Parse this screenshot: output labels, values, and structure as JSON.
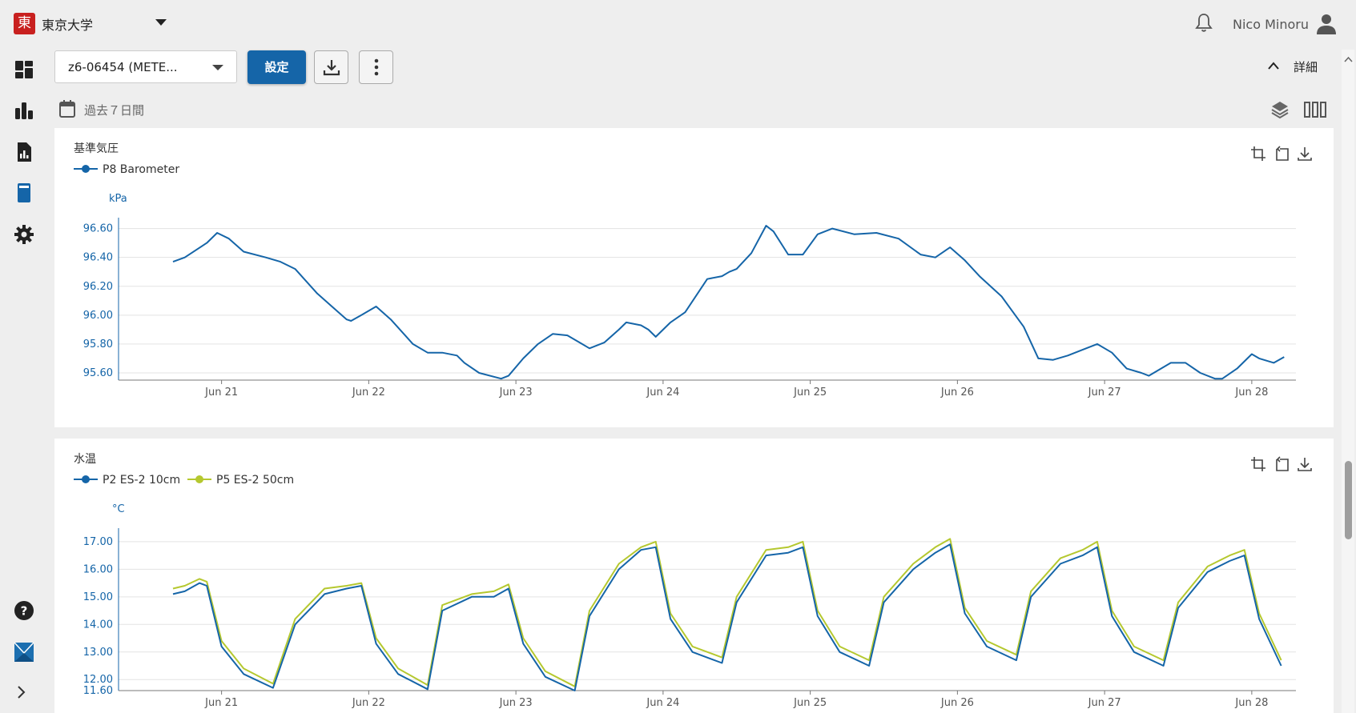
{
  "header": {
    "logo_char": "東",
    "org_name": "東京大学",
    "user_name": "Nico Minoru"
  },
  "toolbar": {
    "device_select_value": "z6-06454 (METE...",
    "settings_label": "設定",
    "details_label": "詳細",
    "period_label": "過去７日間"
  },
  "colors": {
    "accent": "#1565a8",
    "series_blue": "#1565a8",
    "series_green": "#b5c82f",
    "logo_red": "#c8201f"
  },
  "icons": {
    "sidebar": [
      "dashboard-icon",
      "bar-chart-icon",
      "report-icon",
      "notebook-icon",
      "gear-icon",
      "help-icon",
      "app-logo-icon",
      "chevron-right-icon"
    ],
    "toolbar": [
      "download-icon",
      "more-vert-icon",
      "layers-icon",
      "columns-icon",
      "calendar-icon"
    ],
    "chart": [
      "crop-icon",
      "reset-icon",
      "download-icon"
    ]
  },
  "chart_data": [
    {
      "type": "line",
      "title": "基準気圧",
      "ylabel": "kPa",
      "ylim": [
        95.55,
        96.62
      ],
      "yticks": [
        "96.60",
        "96.40",
        "96.20",
        "96.00",
        "95.80",
        "95.60"
      ],
      "xticks": [
        "Jun 21",
        "Jun 22",
        "Jun 23",
        "Jun 24",
        "Jun 25",
        "Jun 26",
        "Jun 27",
        "Jun 28"
      ],
      "xlim": [
        20.3,
        28.3
      ],
      "grid": true,
      "legend": "top-left",
      "series": [
        {
          "name": "P8 Barometer",
          "color": "#1565a8",
          "x": [
            20.67,
            20.75,
            20.9,
            20.97,
            21.05,
            21.15,
            21.3,
            21.4,
            21.5,
            21.65,
            21.75,
            21.85,
            21.88,
            21.95,
            22.05,
            22.15,
            22.3,
            22.4,
            22.5,
            22.6,
            22.65,
            22.75,
            22.9,
            22.95,
            23.05,
            23.15,
            23.25,
            23.35,
            23.45,
            23.5,
            23.6,
            23.7,
            23.75,
            23.85,
            23.9,
            23.95,
            24.05,
            24.15,
            24.3,
            24.4,
            24.45,
            24.5,
            24.6,
            24.7,
            24.75,
            24.85,
            24.95,
            25.05,
            25.15,
            25.3,
            25.45,
            25.6,
            25.75,
            25.85,
            25.95,
            26.05,
            26.15,
            26.3,
            26.45,
            26.55,
            26.65,
            26.75,
            26.85,
            26.95,
            27.05,
            27.15,
            27.25,
            27.3,
            27.45,
            27.55,
            27.65,
            27.75,
            27.8,
            27.9,
            28.0,
            28.05,
            28.15,
            28.22
          ],
          "y": [
            96.37,
            96.4,
            96.5,
            96.57,
            96.53,
            96.44,
            96.4,
            96.37,
            96.32,
            96.15,
            96.06,
            95.97,
            95.96,
            96.0,
            96.06,
            95.97,
            95.8,
            95.74,
            95.74,
            95.72,
            95.67,
            95.6,
            95.56,
            95.58,
            95.7,
            95.8,
            95.87,
            95.86,
            95.8,
            95.77,
            95.81,
            95.9,
            95.95,
            95.93,
            95.9,
            95.85,
            95.95,
            96.02,
            96.25,
            96.27,
            96.3,
            96.32,
            96.43,
            96.62,
            96.58,
            96.42,
            96.42,
            96.56,
            96.6,
            96.56,
            96.57,
            96.53,
            96.42,
            96.4,
            96.47,
            96.38,
            96.27,
            96.13,
            95.92,
            95.7,
            95.69,
            95.72,
            95.76,
            95.8,
            95.74,
            95.63,
            95.6,
            95.58,
            95.67,
            95.67,
            95.6,
            95.56,
            95.56,
            95.63,
            95.73,
            95.7,
            95.67,
            95.71
          ]
        }
      ]
    },
    {
      "type": "line",
      "title": "水温",
      "ylabel": "°C",
      "ylim": [
        11.6,
        17.2
      ],
      "yticks": [
        "17.00",
        "16.00",
        "15.00",
        "14.00",
        "13.00",
        "12.00",
        "11.60"
      ],
      "xticks": [
        "Jun 21",
        "Jun 22",
        "Jun 23",
        "Jun 24",
        "Jun 25",
        "Jun 26",
        "Jun 27",
        "Jun 28"
      ],
      "xlim": [
        20.3,
        28.3
      ],
      "grid": true,
      "legend": "top-left",
      "series": [
        {
          "name": "P2 ES-2 10cm",
          "color": "#1565a8",
          "x": [
            20.67,
            20.75,
            20.85,
            20.9,
            21.0,
            21.15,
            21.35,
            21.5,
            21.7,
            21.85,
            21.95,
            22.05,
            22.2,
            22.4,
            22.5,
            22.7,
            22.85,
            22.95,
            23.05,
            23.2,
            23.4,
            23.5,
            23.7,
            23.85,
            23.95,
            24.05,
            24.2,
            24.4,
            24.5,
            24.7,
            24.85,
            24.95,
            25.05,
            25.2,
            25.4,
            25.5,
            25.7,
            25.85,
            25.95,
            26.05,
            26.2,
            26.4,
            26.5,
            26.7,
            26.85,
            26.95,
            27.05,
            27.2,
            27.4,
            27.5,
            27.7,
            27.85,
            27.95,
            28.05,
            28.2
          ],
          "y": [
            15.1,
            15.2,
            15.5,
            15.4,
            13.2,
            12.2,
            11.7,
            14.0,
            15.1,
            15.3,
            15.4,
            13.3,
            12.2,
            11.65,
            14.5,
            15.0,
            15.0,
            15.3,
            13.3,
            12.1,
            11.6,
            14.3,
            16.0,
            16.7,
            16.8,
            14.2,
            13.0,
            12.6,
            14.8,
            16.5,
            16.6,
            16.8,
            14.3,
            13.0,
            12.5,
            14.8,
            16.0,
            16.6,
            16.9,
            14.4,
            13.2,
            12.7,
            15.0,
            16.2,
            16.5,
            16.8,
            14.3,
            13.0,
            12.5,
            14.6,
            15.9,
            16.3,
            16.5,
            14.2,
            12.5
          ]
        },
        {
          "name": "P5 ES-2 50cm",
          "color": "#b5c82f",
          "x": [
            20.67,
            20.75,
            20.85,
            20.9,
            21.0,
            21.15,
            21.35,
            21.5,
            21.7,
            21.85,
            21.95,
            22.05,
            22.2,
            22.4,
            22.5,
            22.7,
            22.85,
            22.95,
            23.05,
            23.2,
            23.4,
            23.5,
            23.7,
            23.85,
            23.95,
            24.05,
            24.2,
            24.4,
            24.5,
            24.7,
            24.85,
            24.95,
            25.05,
            25.2,
            25.4,
            25.5,
            25.7,
            25.85,
            25.95,
            26.05,
            26.2,
            26.4,
            26.5,
            26.7,
            26.85,
            26.95,
            27.05,
            27.2,
            27.4,
            27.5,
            27.7,
            27.85,
            27.95,
            28.05,
            28.2
          ],
          "y": [
            15.3,
            15.4,
            15.65,
            15.55,
            13.4,
            12.4,
            11.85,
            14.2,
            15.3,
            15.4,
            15.5,
            13.5,
            12.4,
            11.8,
            14.7,
            15.1,
            15.2,
            15.45,
            13.5,
            12.3,
            11.75,
            14.5,
            16.2,
            16.8,
            17.0,
            14.4,
            13.2,
            12.8,
            15.0,
            16.7,
            16.8,
            17.0,
            14.5,
            13.2,
            12.7,
            15.0,
            16.2,
            16.8,
            17.1,
            14.6,
            13.4,
            12.9,
            15.2,
            16.4,
            16.7,
            17.0,
            14.5,
            13.2,
            12.7,
            14.8,
            16.1,
            16.5,
            16.7,
            14.4,
            12.7
          ]
        }
      ]
    }
  ]
}
